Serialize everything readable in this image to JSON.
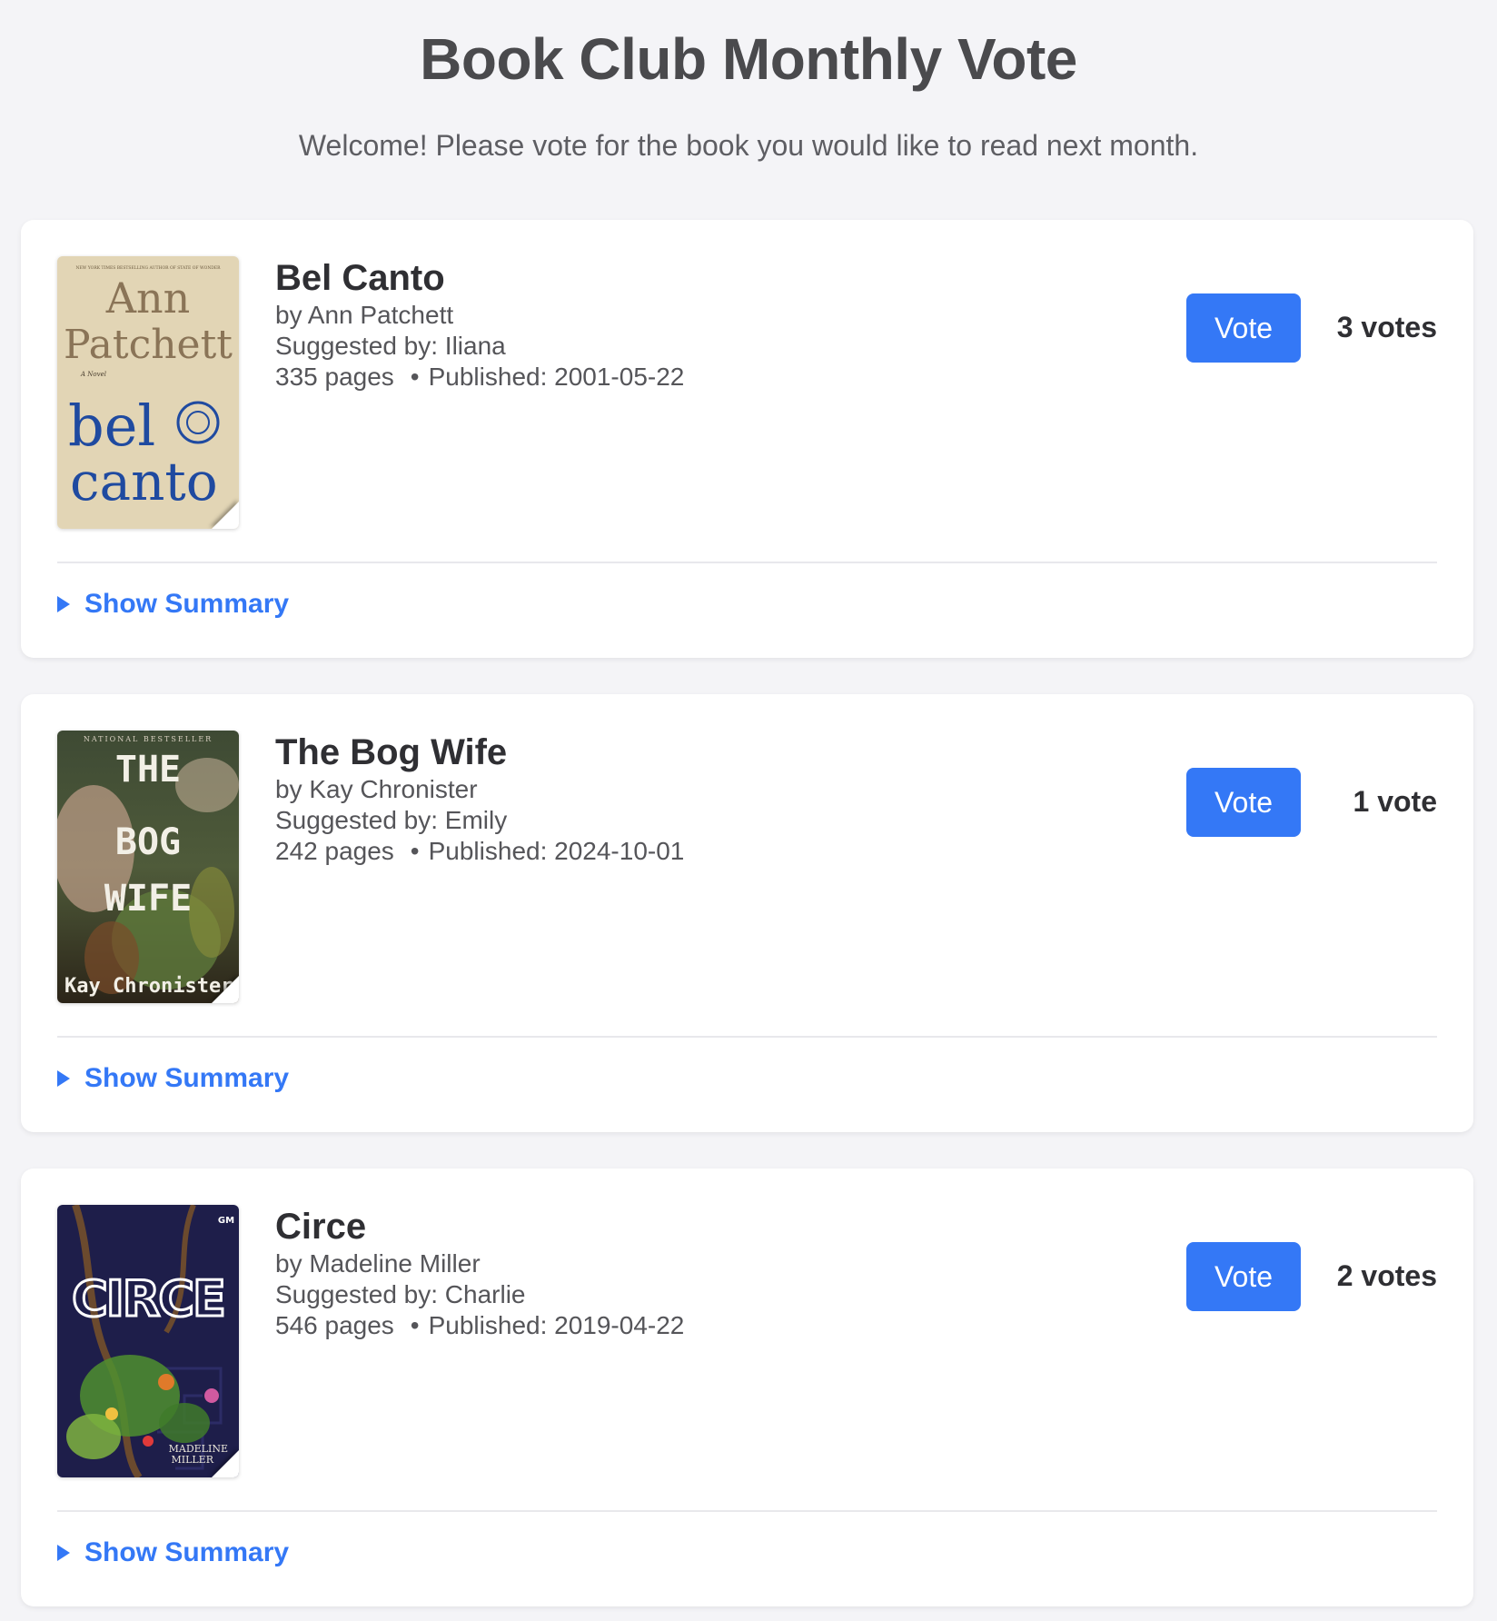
{
  "header": {
    "title": "Book Club Monthly Vote",
    "subtitle": "Welcome! Please vote for the book you would like to read next month."
  },
  "vote_button_label": "Vote",
  "summary_label": "Show Summary",
  "accent_color": "#3478f6",
  "books": [
    {
      "title": "Bel Canto",
      "author_line": "by Ann Patchett",
      "suggested_line": "Suggested by: Iliana",
      "pages": "335 pages",
      "separator": "•",
      "published": "Published: 2001-05-22",
      "votes": "3 votes",
      "cover": {
        "top_line": "NEW YORK TIMES BESTSELLING AUTHOR OF STATE OF WONDER",
        "author_first": "Ann",
        "author_last": "Patchett",
        "tagline": "A Novel",
        "title_a": "bel",
        "title_b": "canto"
      }
    },
    {
      "title": "The Bog Wife",
      "author_line": "by Kay Chronister",
      "suggested_line": "Suggested by: Emily",
      "pages": "242 pages",
      "separator": "•",
      "published": "Published: 2024-10-01",
      "votes": "1 vote",
      "cover": {
        "top_line": "NATIONAL BESTSELLER",
        "word_1": "THE",
        "word_2": "BOG",
        "word_3": "WIFE",
        "author": "Kay Chronister"
      }
    },
    {
      "title": "Circe",
      "author_line": "by Madeline Miller",
      "suggested_line": "Suggested by: Charlie",
      "pages": "546 pages",
      "separator": "•",
      "published": "Published: 2019-04-22",
      "votes": "2 votes",
      "cover": {
        "publisher": "GM",
        "title": "CIRCE",
        "author_first": "MADELINE",
        "author_last": "MILLER"
      }
    }
  ]
}
